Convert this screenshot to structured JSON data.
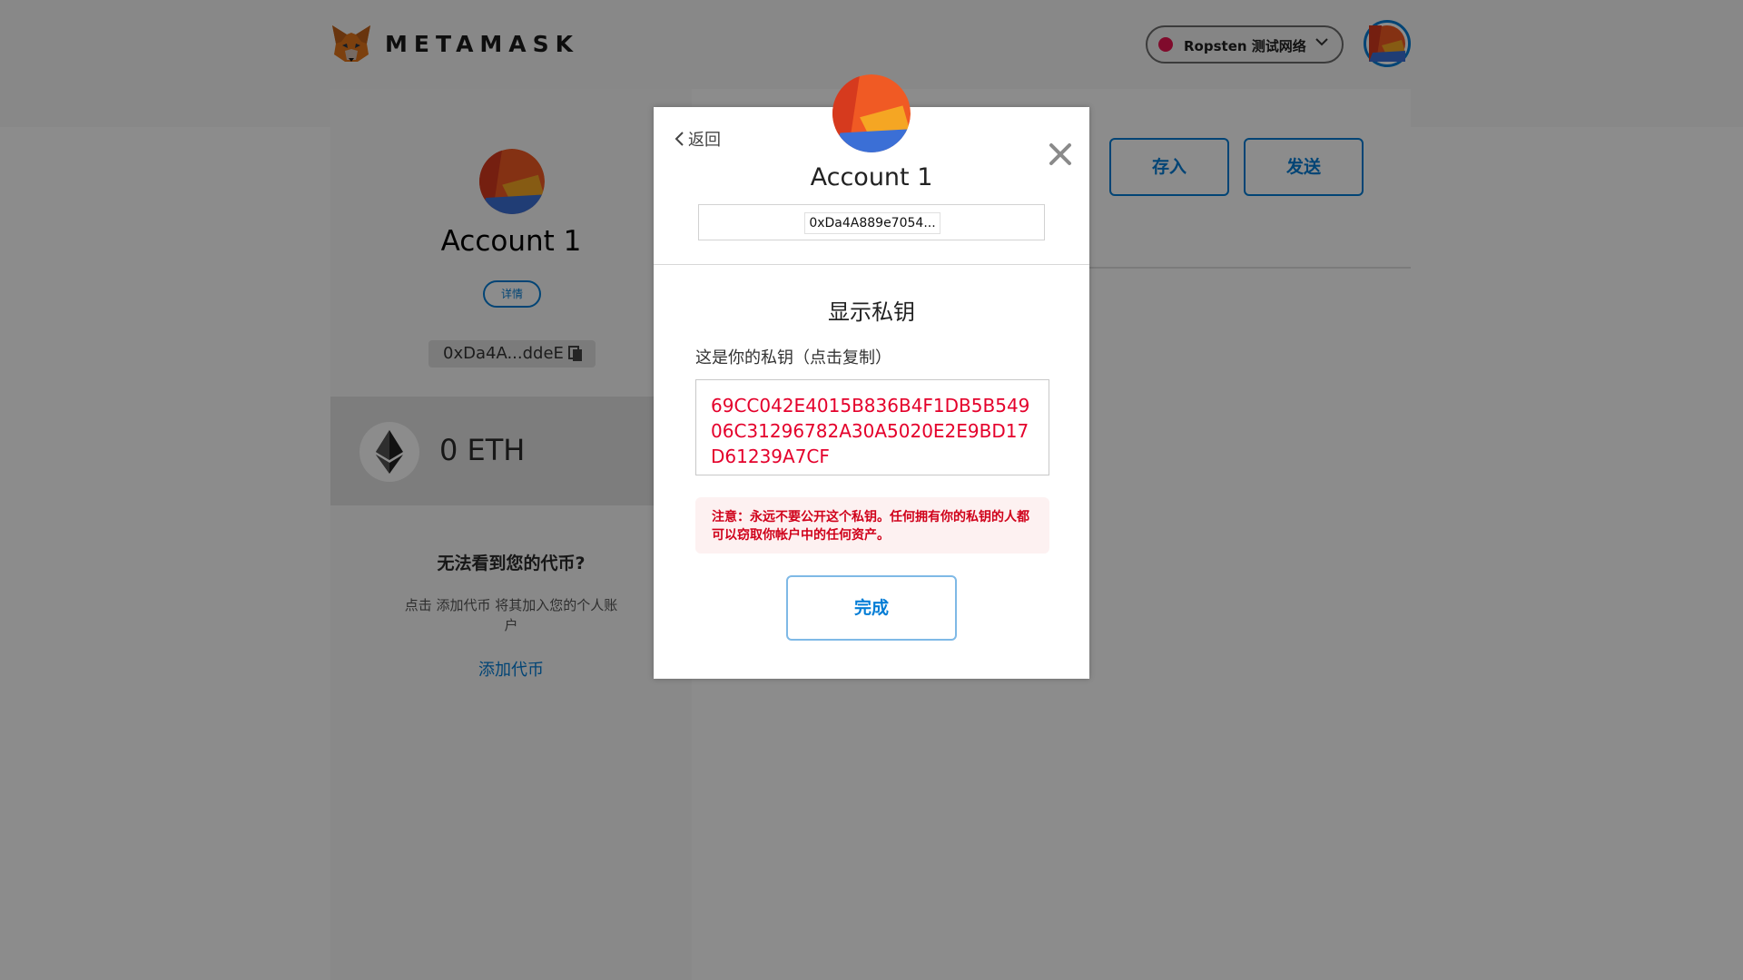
{
  "header": {
    "brand": "METAMASK",
    "network": "Ropsten 测试网络"
  },
  "sidebar": {
    "account_name": "Account 1",
    "details_label": "详情",
    "short_address": "0xDa4A...ddeE",
    "balance": "0 ETH",
    "no_tokens_title": "无法看到您的代币?",
    "no_tokens_help": "点击 添加代币 将其加入您的个人账户",
    "add_token_link": "添加代币"
  },
  "main": {
    "deposit_label": "存入",
    "send_label": "发送"
  },
  "modal": {
    "back_label": "返回",
    "account_name": "Account 1",
    "address": "0xDa4A889e7054...",
    "title": "显示私钥",
    "private_key_label": "这是你的私钥（点击复制）",
    "private_key": "69CC042E4015B836B4F1DB5B54906C31296782A30A5020E2E9BD17D61239A7CF",
    "warning": "注意：永远不要公开这个私钥。任何拥有你的私钥的人都可以窃取你帐户中的任何资产。",
    "done_label": "完成"
  },
  "colors": {
    "accent": "#037dd6",
    "danger": "#e4002b",
    "network_dot": "#e91550",
    "avatar": [
      "#f05a24",
      "#f5a623",
      "#3b6fd6",
      "#d63a1e"
    ]
  },
  "icons": [
    "metamask-fox-icon",
    "chevron-down-icon",
    "copy-icon",
    "ethereum-icon",
    "chevron-left-icon",
    "close-icon"
  ]
}
